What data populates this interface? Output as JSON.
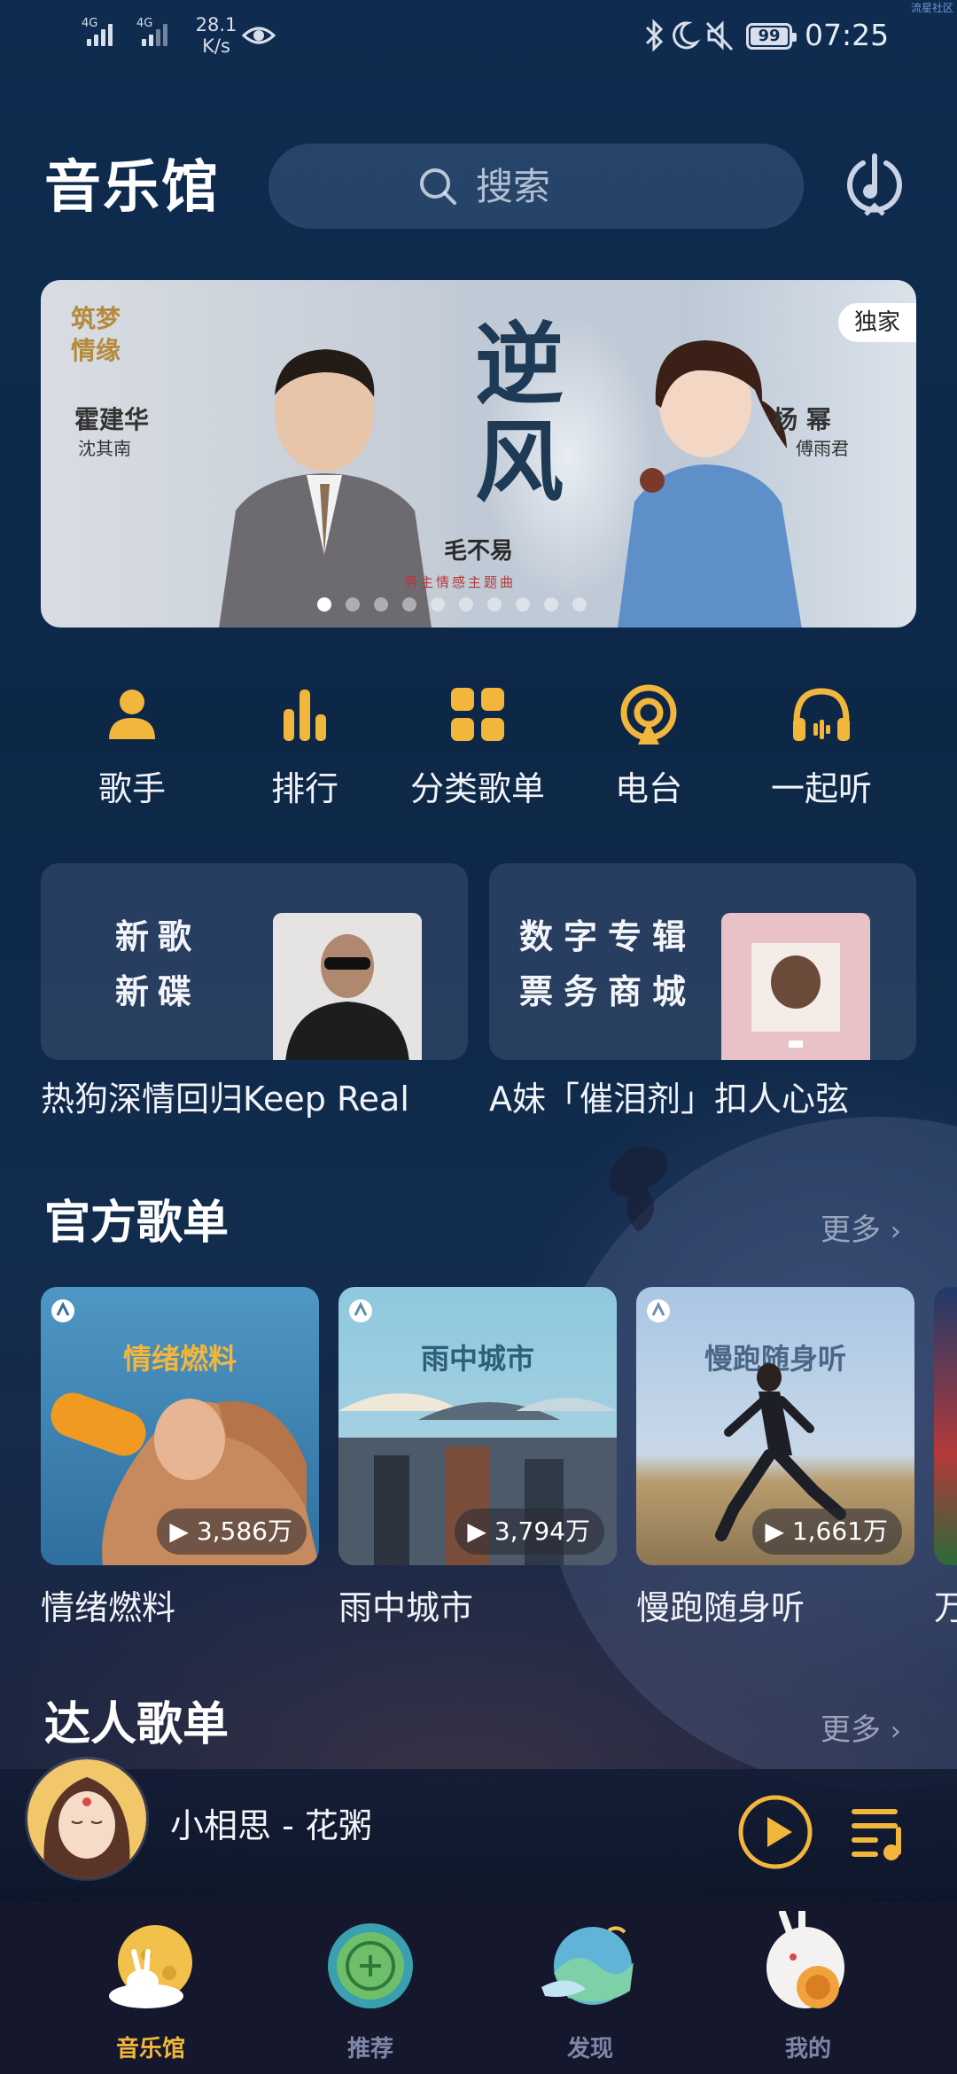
{
  "status_bar": {
    "signal1": "4G",
    "signal2": "4G",
    "speed_value": "28.1",
    "speed_unit": "K/s",
    "battery": "99",
    "time": "07:25"
  },
  "watermark": "流星社区",
  "header": {
    "title": "音乐馆",
    "search_placeholder": "搜索"
  },
  "banner": {
    "big_title": "逆风",
    "sub_title": "毛不易",
    "sub_caption": "男主情感主题曲",
    "left_title": "筑梦情缘",
    "actor_left_name": "霍建华",
    "actor_left_role": "沈其南",
    "actor_right_name": "杨 幂",
    "actor_right_role": "傅雨君",
    "badge": "独家",
    "dot_count": 10,
    "active_dot": 0
  },
  "shortcuts": [
    {
      "label": "歌手",
      "icon": "singer-icon"
    },
    {
      "label": "排行",
      "icon": "chart-icon"
    },
    {
      "label": "分类歌单",
      "icon": "grid-icon"
    },
    {
      "label": "电台",
      "icon": "radio-icon"
    },
    {
      "label": "一起听",
      "icon": "headphones-icon"
    }
  ],
  "promos": [
    {
      "line1": "新歌",
      "line2": "新碟",
      "caption": "热狗深情回归Keep Real"
    },
    {
      "line1": "数字专辑",
      "line2": "票务商城",
      "caption": "A妹「催泪剂」扣人心弦"
    }
  ],
  "official": {
    "title": "官方歌单",
    "more": "更多",
    "playlists": [
      {
        "tag": "情绪燃料",
        "count": "3,586万",
        "name": "情绪燃料"
      },
      {
        "tag": "雨中城市",
        "count": "3,794万",
        "name": "雨中城市"
      },
      {
        "tag": "慢跑随身听",
        "count": "1,661万",
        "name": "慢跑随身听"
      }
    ],
    "partial_name": "万"
  },
  "expert": {
    "title": "达人歌单",
    "more": "更多"
  },
  "player": {
    "song": "小相思 - 花粥"
  },
  "tabs": [
    {
      "label": "音乐馆",
      "active": true
    },
    {
      "label": "推荐",
      "active": false
    },
    {
      "label": "发现",
      "active": false
    },
    {
      "label": "我的",
      "active": false
    }
  ],
  "colors": {
    "accent": "#f2b63c",
    "background_top": "#0f2c50",
    "tab_inactive": "#7f87a8"
  }
}
